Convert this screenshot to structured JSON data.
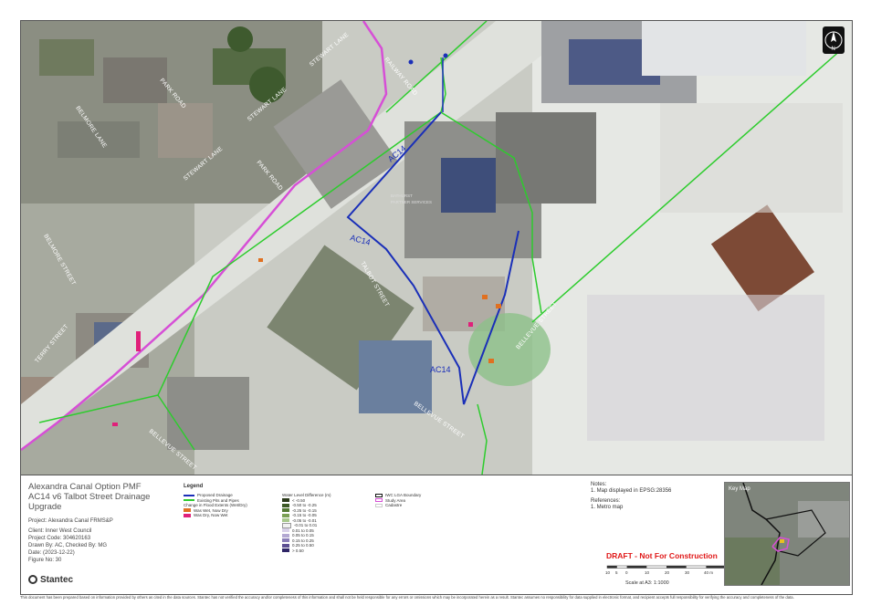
{
  "map": {
    "streets": [
      "RAILWAY ROAD",
      "STEWART LANE",
      "STEWART LANE",
      "STEWART LANE",
      "PARK ROAD",
      "PARK ROAD",
      "BELMORE LANE",
      "BELMORE STREET",
      "TERRY STREET",
      "TALBOT STREET",
      "BELLEVUE STREET",
      "BELLEVUE STREET",
      "BELLEVUE STREET",
      "BELLEVUE STREET"
    ],
    "drainage_labels": [
      "AC14",
      "AC14",
      "AC14"
    ],
    "building_text": [
      "BATHURST",
      "PARTNER SERVICES"
    ],
    "north_arrow_label": "N"
  },
  "title_block": {
    "title_line1": "Alexandra Canal Option PMF",
    "title_line2": "AC14 v6 Talbot Street Drainage",
    "title_line3": "Upgrade",
    "project": "Project: Alexandra Canal FRMS&P",
    "client": "Client:  Inner West Council",
    "project_code": "Project Code:  304620163",
    "drawn_by": "Drawn By:   AC, Checked By: MG",
    "date": "Date:   (2023-12-22)",
    "figure_no": "Figure No:   30",
    "logo": "Stantec"
  },
  "legend": {
    "title": "Legend",
    "items": [
      {
        "label": "Proposed Drainage",
        "color": "#1a2fb8",
        "kind": "line"
      },
      {
        "label": "Existing Pits and Pipes",
        "color": "#2dcc2d",
        "kind": "line"
      },
      {
        "label": "Change in Flood Extents (Wet/Dry)",
        "color": "",
        "kind": "text"
      },
      {
        "label": "Was Wet, Now Dry",
        "color": "#e07020",
        "kind": "box"
      },
      {
        "label": "Was Dry, Now Wet",
        "color": "#e0207a",
        "kind": "box"
      }
    ],
    "wld_title": "Water Level Difference (m)",
    "wld_items": [
      {
        "label": "< -0.50",
        "color": "#2b3a1a"
      },
      {
        "label": "-0.50 to -0.25",
        "color": "#3d5a26"
      },
      {
        "label": "-0.25 to -0.15",
        "color": "#547a34"
      },
      {
        "label": "-0.15 to -0.05",
        "color": "#7aa054"
      },
      {
        "label": "-0.05 to -0.01",
        "color": "#a8c88c"
      },
      {
        "label": "-0.01 to 0.01",
        "color": "#f2f2f2"
      },
      {
        "label": "0.01 to 0.05",
        "color": "#d8d0e8"
      },
      {
        "label": "0.05 to 0.15",
        "color": "#b3a8d2"
      },
      {
        "label": "0.15 to 0.25",
        "color": "#8a7db8"
      },
      {
        "label": "0.25 to 0.50",
        "color": "#5c4e92"
      },
      {
        "label": "> 0.50",
        "color": "#2e2566"
      }
    ],
    "other_items": [
      {
        "label": "IWC LGA Boundary",
        "color": "#111111"
      },
      {
        "label": "Study Area",
        "color": "#d64fd6"
      },
      {
        "label": "Cadastre",
        "color": "#cccccc"
      }
    ]
  },
  "notes": {
    "notes_title": "Notes:",
    "note_1": "1. Map displayed in EPSG:28356",
    "refs_title": "References:",
    "ref_1": "1. Metro map"
  },
  "draft_stamp": "DRAFT - Not For Construction",
  "scale": {
    "ticks": [
      "10",
      "5",
      "0",
      "10",
      "20",
      "30",
      "40 m"
    ],
    "label": "Scale at A3: 1:1000"
  },
  "key_map": {
    "title": "Key Map"
  },
  "disclaimer": "This document has been prepared based on information provided by others as cited in the data sources. Stantec has not verified the accuracy and/or completeness of this information and shall not be held responsible for any errors or omissions which may be incorporated herein as a result. Stantec assumes no responsibility for data supplied in electronic format, and recipient accepts full responsibility for verifying the accuracy and completeness of the data.",
  "colors": {
    "proposed_drainage": "#1a2fb8",
    "existing_pipes": "#2dcc2d",
    "study_area": "#d64fd6",
    "draft_red": "#e01818"
  }
}
